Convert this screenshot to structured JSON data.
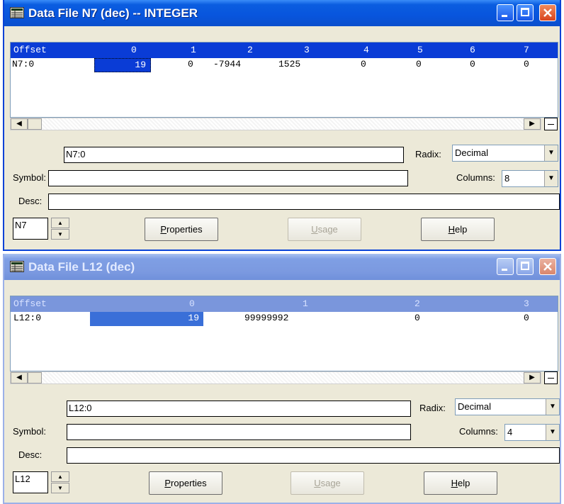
{
  "windows": [
    {
      "title": "Data File N7 (dec)  --  INTEGER",
      "grid": {
        "header": [
          "Offset",
          "0",
          "1",
          "2",
          "3",
          "4",
          "5",
          "6",
          "7"
        ],
        "row": [
          "N7:0",
          "19",
          "0",
          "-7944",
          "1525",
          "0",
          "0",
          "0",
          "0"
        ]
      },
      "address": "N7:0",
      "radix_label": "Radix:",
      "radix_value": "Decimal",
      "symbol_label": "Symbol:",
      "symbol_value": "",
      "columns_label": "Columns:",
      "columns_value": "8",
      "desc_label": "Desc:",
      "desc_value": "",
      "file_spin": "N7",
      "buttons": {
        "properties_first": "P",
        "properties_rest": "roperties",
        "usage_first": "U",
        "usage_rest": "sage",
        "help_first": "H",
        "help_rest": "elp"
      }
    },
    {
      "title": "Data File L12 (dec)",
      "grid": {
        "header": [
          "Offset",
          "0",
          "1",
          "2",
          "3"
        ],
        "row": [
          "L12:0",
          "19",
          "99999992",
          "0",
          "0"
        ]
      },
      "address": "L12:0",
      "radix_label": "Radix:",
      "radix_value": "Decimal",
      "symbol_label": "Symbol:",
      "symbol_value": "",
      "columns_label": "Columns:",
      "columns_value": "4",
      "desc_label": "Desc:",
      "desc_value": "",
      "file_spin": "L12",
      "buttons": {
        "properties_first": "P",
        "properties_rest": "roperties",
        "usage_first": "U",
        "usage_rest": "sage",
        "help_first": "H",
        "help_rest": "elp"
      }
    }
  ],
  "icons": {
    "app_icon": "data-table-icon",
    "minimize": "minimize-icon",
    "maximize": "maximize-icon",
    "close": "close-icon"
  },
  "colors": {
    "active_title": "#0a5de0",
    "inactive_title": "#7b99e0",
    "selection": "#0a3cd6"
  }
}
